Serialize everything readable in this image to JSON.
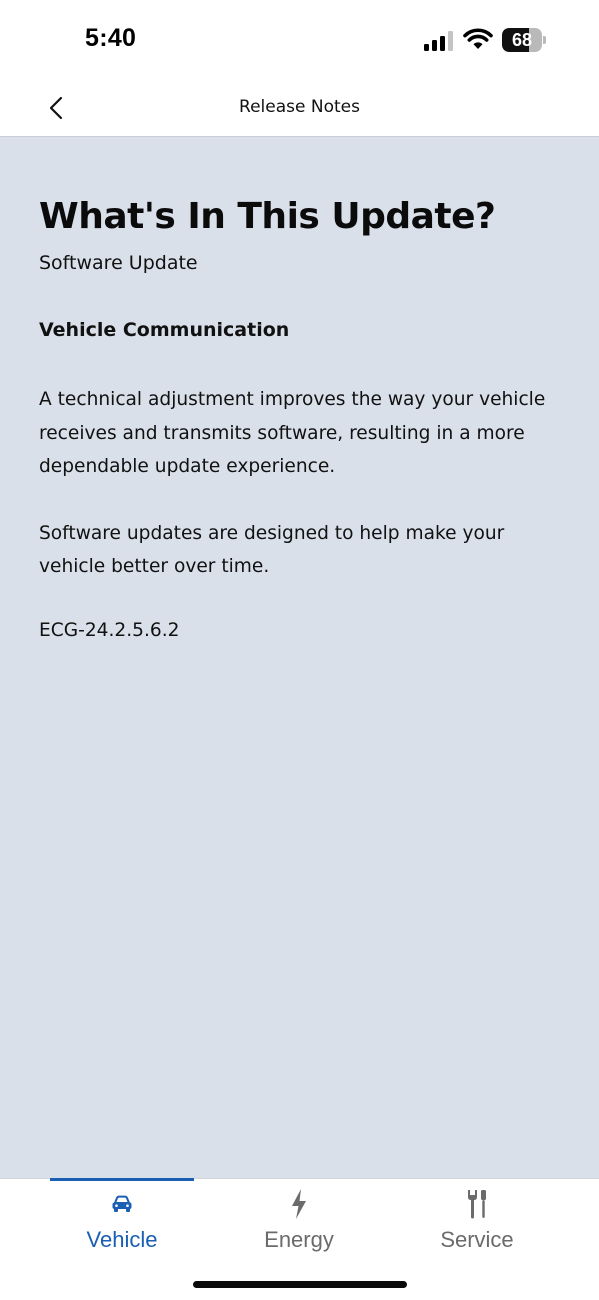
{
  "status_bar": {
    "time": "5:40",
    "battery_level": "68",
    "battery_fraction": 0.68,
    "icons": [
      "signal-icon",
      "wifi-icon",
      "battery-icon"
    ]
  },
  "header": {
    "back_icon": "chevron-left-icon",
    "title": "Release Notes"
  },
  "content": {
    "title": "What's In This Update?",
    "subtitle": "Software Update",
    "section_heading": "Vehicle Communication",
    "paragraphs": [
      "A technical adjustment improves the way your vehicle receives and transmits software, resulting in a more dependable update experience.",
      "Software updates are designed to help make your vehicle better over time."
    ],
    "version": "ECG-24.2.5.6.2"
  },
  "tab_bar": {
    "tabs": [
      {
        "label": "Vehicle",
        "icon": "car-icon",
        "active": true
      },
      {
        "label": "Energy",
        "icon": "lightning-bolt-icon",
        "active": false
      },
      {
        "label": "Service",
        "icon": "wrench-screwdriver-icon",
        "active": false
      }
    ]
  },
  "colors": {
    "accent": "#1b5fb3",
    "content_background": "#d9e0ea",
    "inactive_tab": "#6b6b6b"
  }
}
